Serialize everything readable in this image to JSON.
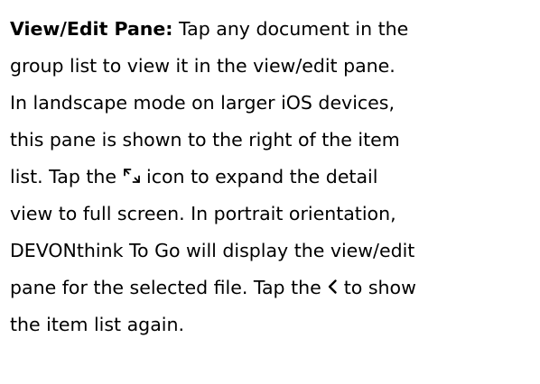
{
  "paragraph": {
    "lead": "View/Edit Pane:",
    "line1_rest": " Tap any document in the",
    "line2": "group list to view it in the view/edit pane.",
    "line3": "In landscape mode on larger iOS devices,",
    "line4": "this pane is shown to the right of the item",
    "line5_before_icon": "list. Tap the ",
    "line5_after_icon": " icon to expand the detail",
    "line6": "view to full screen. In portrait orientation,",
    "line7": "DEVONthink To Go will display the view/edit",
    "line8_before_icon": "pane for the selected file. Tap the ",
    "line8_after_icon": " to show",
    "line9": "the item list again."
  },
  "icons": {
    "expand": "expand-arrows-icon",
    "back": "chevron-left-icon"
  }
}
